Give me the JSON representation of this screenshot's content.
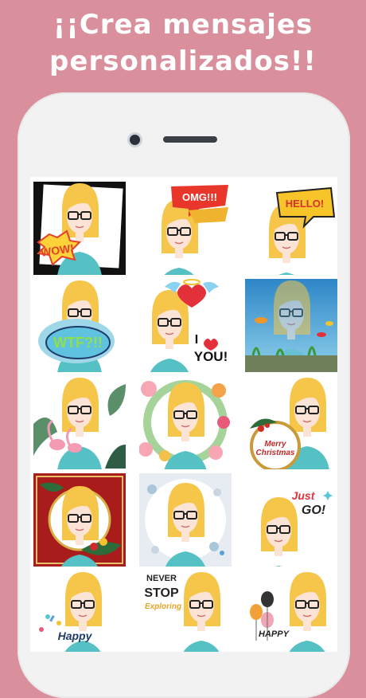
{
  "headline": {
    "line1": "¡¡Crea mensajes",
    "line2": "personalizados!!"
  },
  "stickers": [
    {
      "theme": "wow",
      "text": "WOW!"
    },
    {
      "theme": "omg",
      "text": "OMG!!!"
    },
    {
      "theme": "hello",
      "text": "HELLO!"
    },
    {
      "theme": "wtf",
      "text": "WTF?!!"
    },
    {
      "theme": "love",
      "text_top": "I",
      "text_bottom": "YOU!"
    },
    {
      "theme": "aquarium",
      "text": ""
    },
    {
      "theme": "flamingo",
      "text": ""
    },
    {
      "theme": "flowers",
      "text": ""
    },
    {
      "theme": "merry-christmas",
      "text": "Merry Christmas"
    },
    {
      "theme": "christmas-wreath",
      "text": ""
    },
    {
      "theme": "snowflakes",
      "text": ""
    },
    {
      "theme": "just-go",
      "text_top": "Just",
      "text_bottom": "GO!"
    },
    {
      "theme": "happy-birthday",
      "text": "Happy"
    },
    {
      "theme": "never-stop",
      "text_top": "NEVER",
      "text_mid": "STOP",
      "text_bottom": "Exploring"
    },
    {
      "theme": "balloons",
      "text": "HAPPY"
    }
  ],
  "colors": {
    "background": "#d98f9c",
    "hair": "#f5c64a",
    "skin": "#fbe4d6",
    "shirt": "#56c1c5",
    "glasses": "#222222"
  }
}
